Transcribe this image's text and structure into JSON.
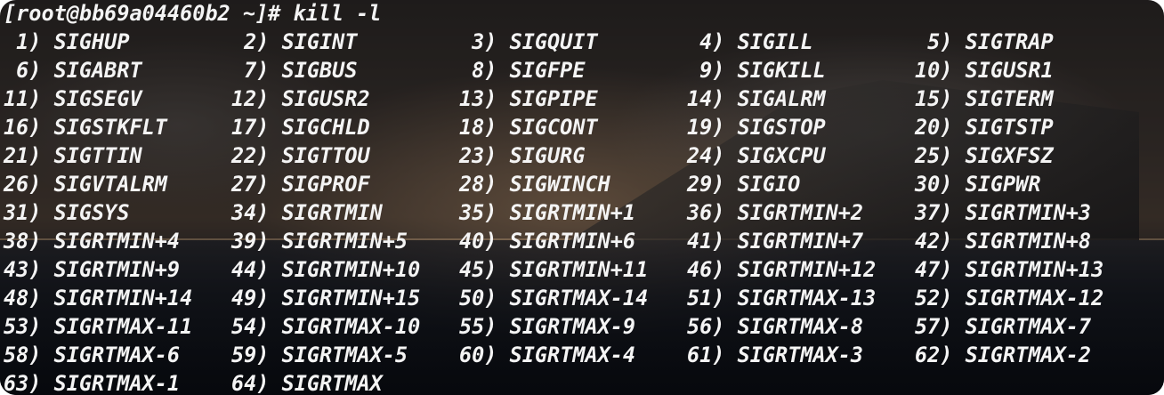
{
  "window": {
    "prompt": "[root@bb69a04460b2 ~]# ",
    "command": "kill -l"
  },
  "output": {
    "rows": [
      [
        " 1) SIGHUP",
        " 2) SIGINT",
        " 3) SIGQUIT",
        " 4) SIGILL",
        " 5) SIGTRAP"
      ],
      [
        " 6) SIGABRT",
        " 7) SIGBUS",
        " 8) SIGFPE",
        " 9) SIGKILL",
        "10) SIGUSR1"
      ],
      [
        "11) SIGSEGV",
        "12) SIGUSR2",
        "13) SIGPIPE",
        "14) SIGALRM",
        "15) SIGTERM"
      ],
      [
        "16) SIGSTKFLT",
        "17) SIGCHLD",
        "18) SIGCONT",
        "19) SIGSTOP",
        "20) SIGTSTP"
      ],
      [
        "21) SIGTTIN",
        "22) SIGTTOU",
        "23) SIGURG",
        "24) SIGXCPU",
        "25) SIGXFSZ"
      ],
      [
        "26) SIGVTALRM",
        "27) SIGPROF",
        "28) SIGWINCH",
        "29) SIGIO",
        "30) SIGPWR"
      ],
      [
        "31) SIGSYS",
        "34) SIGRTMIN",
        "35) SIGRTMIN+1",
        "36) SIGRTMIN+2",
        "37) SIGRTMIN+3"
      ],
      [
        "38) SIGRTMIN+4",
        "39) SIGRTMIN+5",
        "40) SIGRTMIN+6",
        "41) SIGRTMIN+7",
        "42) SIGRTMIN+8"
      ],
      [
        "43) SIGRTMIN+9",
        "44) SIGRTMIN+10",
        "45) SIGRTMIN+11",
        "46) SIGRTMIN+12",
        "47) SIGRTMIN+13"
      ],
      [
        "48) SIGRTMIN+14",
        "49) SIGRTMIN+15",
        "50) SIGRTMAX-14",
        "51) SIGRTMAX-13",
        "52) SIGRTMAX-12"
      ],
      [
        "53) SIGRTMAX-11",
        "54) SIGRTMAX-10",
        "55) SIGRTMAX-9",
        "56) SIGRTMAX-8",
        "57) SIGRTMAX-7"
      ],
      [
        "58) SIGRTMAX-6",
        "59) SIGRTMAX-5",
        "60) SIGRTMAX-4",
        "61) SIGRTMAX-3",
        "62) SIGRTMAX-2"
      ],
      [
        "63) SIGRTMAX-1",
        "64) SIGRTMAX"
      ]
    ]
  },
  "colors": {
    "text": "#f4f4f4"
  }
}
